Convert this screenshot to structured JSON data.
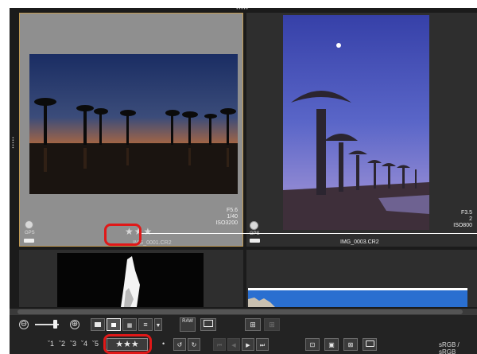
{
  "grid": {
    "cells": [
      {
        "aperture": "F5.6",
        "shutter": "1/40",
        "iso": "ISO3200",
        "gps": "GPS",
        "stars": "★★★",
        "filename": "IMG_0001.CR2"
      },
      {
        "aperture": "F3.5",
        "shutter": "2",
        "iso": "ISO800",
        "gps": "GPS",
        "filename": "IMG_0003.CR2"
      }
    ]
  },
  "toolbar1": {
    "zoom_out": "⊖",
    "zoom_in": "⊕",
    "view_raw": "RAW"
  },
  "toolbar2": {
    "ratings": [
      "1",
      "2",
      "3",
      "4",
      "5"
    ],
    "stars": "★★★",
    "dot": "•",
    "profile": "sRGB / sRGB"
  },
  "colors": {
    "highlight": "#e01818",
    "selected_border": "#c09a55"
  }
}
